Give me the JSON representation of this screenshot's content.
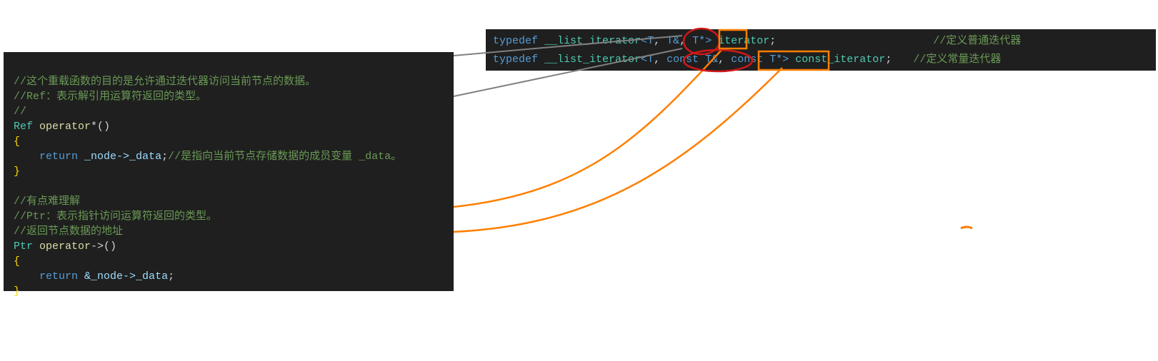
{
  "left": {
    "c1": "//这个重载函数的目的是允许通过迭代器访问当前节点的数据。",
    "c2": "//Ref：表示解引用运算符返回的类型。",
    "c3": "//",
    "refType": "Ref",
    "opStar": "operator",
    "opStarSym": "*()",
    "ret1": "return",
    "ret1expr": "_node->_data",
    "c4": "//是指向当前节点存储数据的成员变量 _data。",
    "c5": "//有点难理解",
    "c6": "//Ptr：表示指针访问运算符返回的类型。",
    "c7": "//返回节点数据的地址",
    "ptrType": "Ptr",
    "opArrow": "operator",
    "opArrowSym": "->()",
    "ret2": "return",
    "ret2expr": "&_node->_data"
  },
  "right": {
    "td": "typedef",
    "it": "__list_iterator",
    "T": "T",
    "const": "const",
    "iter": "iterator",
    "citer": "const_iterator",
    "cm1": "//定义普通迭代器",
    "cm2": "//定义常量迭代器"
  },
  "colors": {
    "orange": "#ff7f00",
    "red": "#d01818",
    "grey": "#808080"
  }
}
